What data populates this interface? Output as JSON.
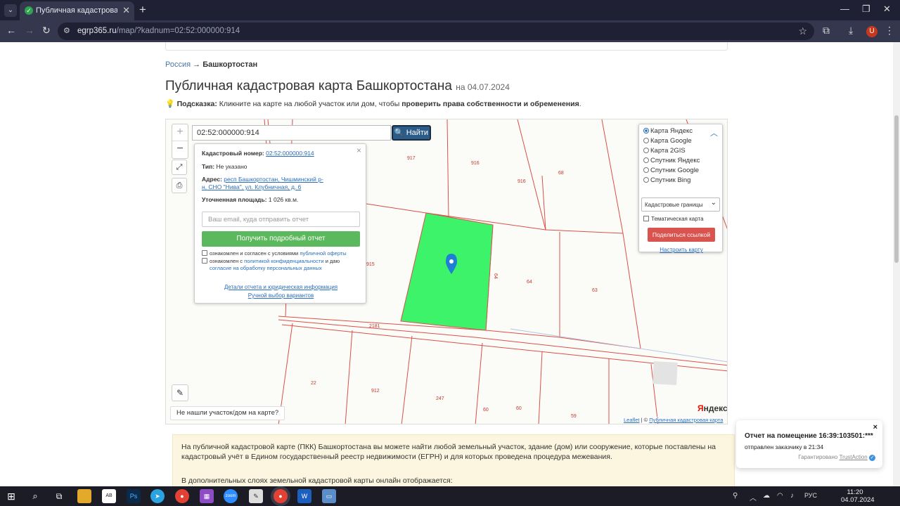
{
  "browser": {
    "tab_title": "Публичная кадастровая карта",
    "url_host": "egrp365.ru",
    "url_path": "/map/?kadnum=02:52:000000:914",
    "profile_initial": "U"
  },
  "breadcrumb": {
    "root": "Россия",
    "arrow": "→",
    "current": "Башкортостан"
  },
  "page_title": "Публичная кадастровая карта Башкортостана",
  "page_date": "на 04.07.2024",
  "hint": {
    "label": "Подсказка:",
    "text": "Кликните на карте на любой участок или дом, чтобы",
    "bold": "проверить права собственности и обременения",
    "end": "."
  },
  "map": {
    "search_value": "02:52:000000:914",
    "find_label": "Найти",
    "zoom_in": "+",
    "zoom_out": "−",
    "not_found": "Не нашли участок/дом на карте?",
    "yandex_logo_black": "Я",
    "yandex_logo_red": "ндекс",
    "attribution_leaflet": "Leaflet",
    "attribution_sep": " | © ",
    "attribution_pkk": "Публичная кадастровая карта",
    "plot_labels": [
      "917",
      "916",
      "916",
      "68",
      "915",
      "64",
      "64",
      "63",
      "2181",
      "22",
      "912",
      "247",
      "60",
      "60",
      "59"
    ]
  },
  "popup": {
    "cadnum_label": "Кадастровый номер:",
    "cadnum_value": "02:52:000000:914",
    "type_label": "Тип:",
    "type_value": "Не указано",
    "address_label": "Адрес:",
    "address_line1": "респ Башкортостан, Чишминский р-",
    "address_line2": "н, СНО \"Нива\", ул. Клубничная, д. 6",
    "area_label": "Уточненная площадь:",
    "area_value": "1 026 кв.м.",
    "email_placeholder": "Ваш email, куда отправить отчет",
    "get_report": "Получить подробный отчет",
    "check1_text": "ознакомлен и согласен с условиями",
    "check1_link": "публичной оферты",
    "check2_text": "ознакомлен с",
    "check2_link": "политикой конфиденциальности",
    "check2_and": "и даю",
    "check2_link2": "согласие на обработку персональных данных",
    "details_link": "Детали отчета и юридическая информация",
    "manual_link": "Ручной выбор вариантов",
    "close": "×"
  },
  "layers": {
    "options": [
      "Карта Яндекс",
      "Карта Google",
      "Карта 2GIS",
      "Спутник Яндекс",
      "Спутник Google",
      "Спутник Bing"
    ],
    "selected_index": 0,
    "select_value": "Кадастровые границы",
    "thematic": "Тематическая карта",
    "share": "Поделиться ссылкой",
    "configure": "Настроить карту"
  },
  "info": {
    "para1": "На публичной кадастровой карте (ПКК) Башкортостана вы можете найти любой земельный участок, здание (дом) или сооружение, которые поставлены на кадастровый учёт в Едином государственный реестр недвижимости (ЕГРН) и для которых проведена процедура межевания.",
    "para2": "В дополнительных слоях земельной кадастровой карты онлайн отображается:"
  },
  "toast": {
    "title": "Отчет на помещение 16:39:103501:***",
    "sent": "отправлен заказчику в 21:34",
    "guarantee": "Гарантировано",
    "brand": "TrustAction",
    "close": "×"
  },
  "taskbar": {
    "lang": "РУС",
    "time": "11:20",
    "date": "04.07.2024"
  },
  "colors": {
    "highlight_plot": "#3cf36a",
    "boundary": "#d9504a",
    "marker": "#1f7fd6"
  }
}
